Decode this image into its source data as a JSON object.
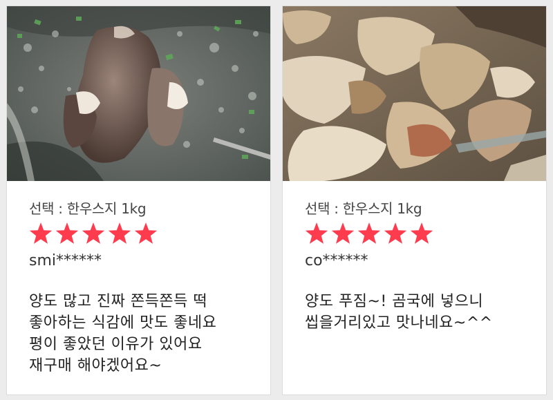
{
  "colors": {
    "star": "#ff3b4e",
    "background": "#ececec",
    "card": "#ffffff"
  },
  "reviews": [
    {
      "photo": "beef-tendon-soup-photo",
      "option": "선택 : 한우스지 1kg",
      "rating": 5,
      "rating_max": 5,
      "user": "smi******",
      "text": "양도 많고 진짜 쫀득쫀득 떡\n좋아하는 식감에 맛도 좋네요\n평이 좋았던 이유가 있어요\n재구매 해야겠어요~"
    },
    {
      "photo": "boiled-beef-tendon-container-photo",
      "option": "선택 : 한우스지 1kg",
      "rating": 5,
      "rating_max": 5,
      "user": "co******",
      "text": "양도 푸짐~! 곰국에 넣으니\n씹을거리있고 맛나네요~^^"
    }
  ]
}
